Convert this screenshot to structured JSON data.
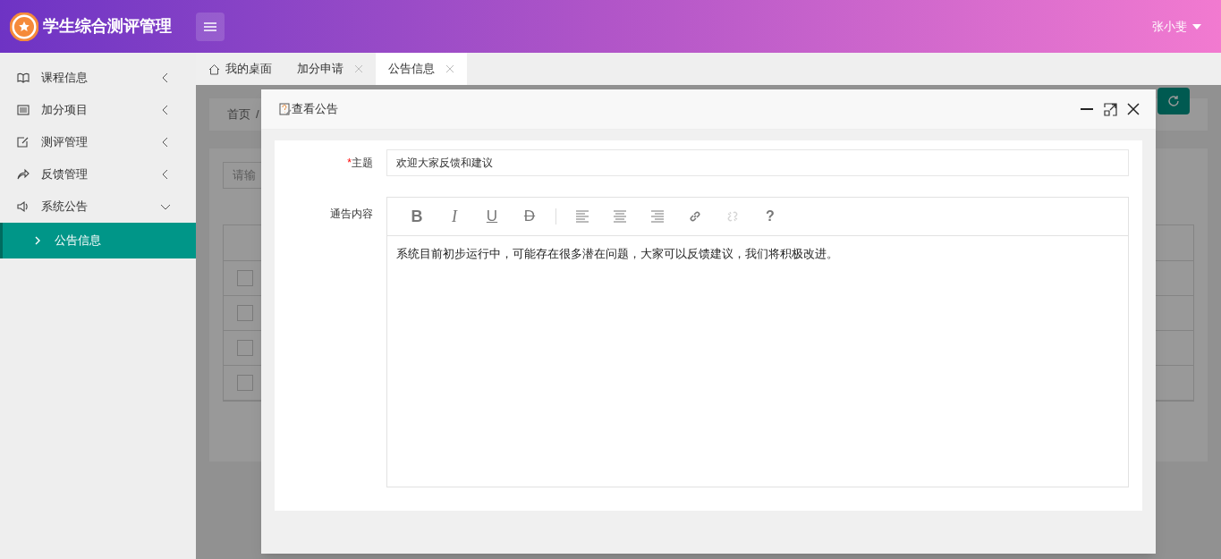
{
  "header": {
    "title": "学生综合测评管理",
    "user": "张小斐"
  },
  "sidebar": {
    "items": [
      {
        "label": "课程信息",
        "expanded": false
      },
      {
        "label": "加分项目",
        "expanded": false
      },
      {
        "label": "测评管理",
        "expanded": false
      },
      {
        "label": "反馈管理",
        "expanded": false
      },
      {
        "label": "系统公告",
        "expanded": true,
        "children": [
          {
            "label": "公告信息",
            "selected": true
          }
        ]
      }
    ]
  },
  "tabs": [
    {
      "label": "我的桌面",
      "selected": false,
      "closable": false
    },
    {
      "label": "加分申请",
      "selected": false,
      "closable": true
    },
    {
      "label": "公告信息",
      "selected": true,
      "closable": true
    }
  ],
  "background": {
    "breadcrumb": [
      "首页",
      "/"
    ],
    "search_placeholder": "请输",
    "rows": [
      {
        "checked": false
      },
      {
        "checked": false
      },
      {
        "checked": false
      },
      {
        "checked": false
      }
    ]
  },
  "dialog": {
    "title": "查看公告",
    "subject": {
      "label": "主题",
      "required_mark": "*",
      "value": "欢迎大家反馈和建议"
    },
    "content": {
      "label": "通告内容",
      "text": "系统目前初步运行中，可能存在很多潜在问题，大家可以反馈建议，我们将积极改进。"
    },
    "toolbar": [
      {
        "kind": "glyph",
        "label": "B",
        "disabled": false
      },
      {
        "kind": "glyph",
        "label": "I",
        "disabled": false
      },
      {
        "kind": "glyph",
        "label": "U",
        "disabled": false
      },
      {
        "kind": "glyph",
        "label": "D",
        "disabled": false
      },
      {
        "kind": "separator"
      },
      {
        "kind": "icon",
        "disabled": false
      },
      {
        "kind": "icon",
        "disabled": false
      },
      {
        "kind": "icon",
        "disabled": false
      },
      {
        "kind": "icon",
        "disabled": false
      },
      {
        "kind": "icon",
        "disabled": true
      },
      {
        "kind": "glyph",
        "label": "?",
        "disabled": false
      }
    ]
  }
}
